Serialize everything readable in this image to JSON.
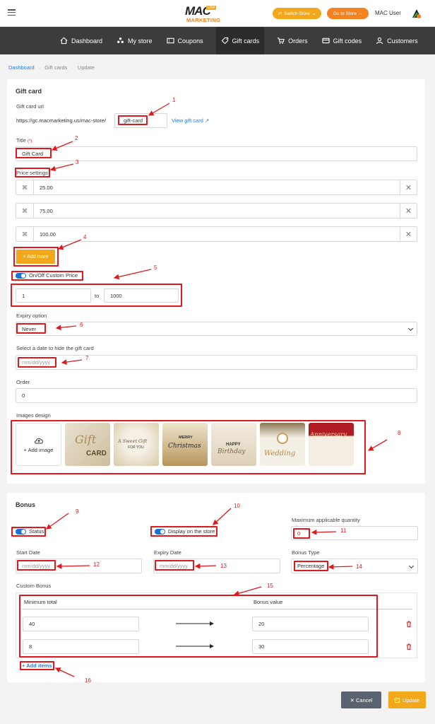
{
  "header": {
    "logo_main": "MAC",
    "logo_sub": "MARKETING",
    "logo_badge": "USA",
    "switch_store": "Switch Store",
    "go_to_store": "Go to Store →",
    "user_name": "MAC User"
  },
  "nav": [
    {
      "label": "Dashboard",
      "icon": "home-icon"
    },
    {
      "label": "My store",
      "icon": "store-icon"
    },
    {
      "label": "Coupons",
      "icon": "coupon-icon"
    },
    {
      "label": "Gift cards",
      "icon": "tag-icon"
    },
    {
      "label": "Orders",
      "icon": "cart-icon"
    },
    {
      "label": "Gift codes",
      "icon": "card-icon"
    },
    {
      "label": "Customers",
      "icon": "user-icon"
    }
  ],
  "breadcrumb": {
    "home": "Dashboard",
    "sep": "·",
    "parent": "Gift cards",
    "current": "Update"
  },
  "gift_card": {
    "section_title": "Gift card",
    "url_label": "Gift card url",
    "url_prefix": "https://gc.macmarketing.us/mac-store/",
    "url_slug": "gift-card",
    "view_link": "View gift card ↗",
    "title_label": "Title",
    "required_mark": "(*)",
    "title_value": "Gift Card",
    "price_settings_label": "Price settings",
    "prices": [
      "25.00",
      "75.00",
      "100.00"
    ],
    "add_more": "+ Add more",
    "custom_price_label": "On/Off Custom Price",
    "custom_min": "1",
    "custom_to": "to",
    "custom_max": "1000",
    "expiry_label": "Expiry option",
    "expiry_value": "Never",
    "hide_date_label": "Select a date to hide the gift card",
    "date_placeholder": "mm/dd/yyyy",
    "order_label": "Order",
    "order_value": "0",
    "images_label": "Images design",
    "add_image": "+ Add image",
    "designs": [
      {
        "line1": "Gift",
        "line2": "CARD"
      },
      {
        "line1": "A Sweet Gift",
        "line2": "FOR YOU"
      },
      {
        "line1": "MERRY",
        "line2": "Christmas"
      },
      {
        "line1": "HAPPY",
        "line2": "Birthday"
      },
      {
        "line1": "Wedding",
        "line2": ""
      },
      {
        "line1": "Anniversary",
        "line2": ""
      }
    ]
  },
  "bonus": {
    "section_title": "Bonus",
    "status_label": "Status",
    "display_label": "Display on the store",
    "max_qty_label": "Maximum applicable quantity",
    "max_qty_value": "0",
    "start_date_label": "Start Date",
    "expiry_date_label": "Expiry Date",
    "date_placeholder": "mm/dd/yyyy",
    "bonus_type_label": "Bonus Type",
    "bonus_type_value": "Percentage",
    "custom_bonus_label": "Custom Bonus",
    "col_min_total": "Minimum total",
    "col_bonus_value": "Bonus value",
    "rows": [
      {
        "min": "40",
        "value": "20"
      },
      {
        "min": "8",
        "value": "30"
      }
    ],
    "add_items": "+ Add items"
  },
  "footer": {
    "cancel": "✕ Cancel",
    "update": "Update"
  },
  "annotations": [
    "1",
    "2",
    "3",
    "4",
    "5",
    "6",
    "7",
    "8",
    "9",
    "10",
    "11",
    "12",
    "13",
    "14",
    "15",
    "16"
  ],
  "colors": {
    "accent": "#f2a81a",
    "dark_nav": "#3c3c3c",
    "annotation_red": "#e0191f",
    "link_blue": "#2a7bd6",
    "orange_btn": "#f58220"
  }
}
